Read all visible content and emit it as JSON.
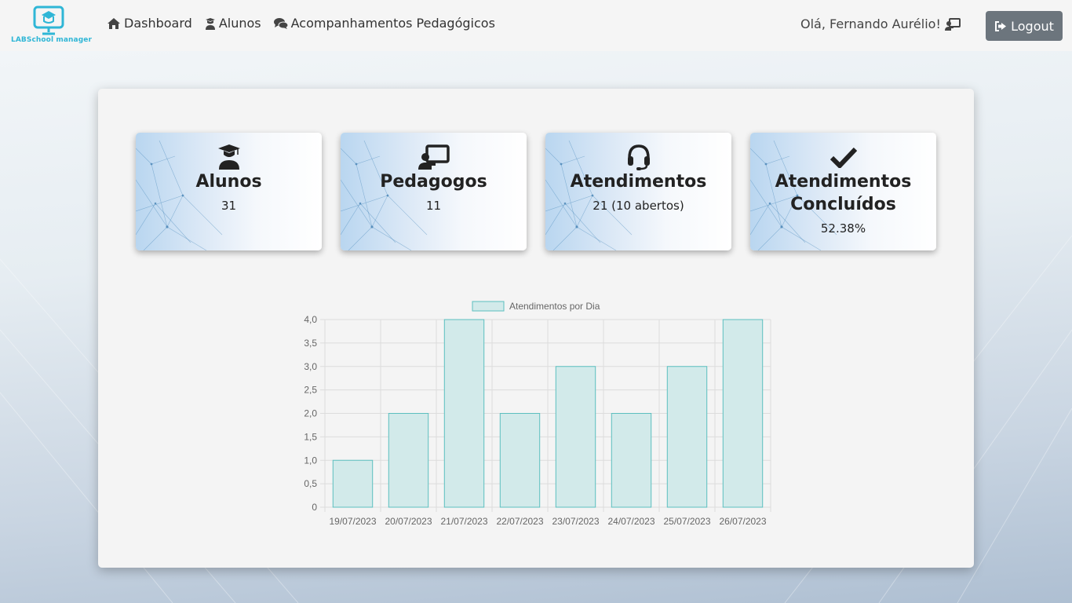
{
  "brand": {
    "name": "LABSchool manager"
  },
  "nav": {
    "items": [
      {
        "label": "Dashboard",
        "icon": "home-icon"
      },
      {
        "label": "Alunos",
        "icon": "student-icon"
      },
      {
        "label": "Acompanhamentos Pedagógicos",
        "icon": "comments-icon"
      }
    ]
  },
  "user": {
    "greeting": "Olá, Fernando Aurélio!"
  },
  "logout": {
    "label": "Logout"
  },
  "cards": [
    {
      "title": "Alunos",
      "value": "31",
      "icon": "graduation-cap-icon"
    },
    {
      "title": "Pedagogos",
      "value": "11",
      "icon": "chalkboard-teacher-icon"
    },
    {
      "title": "Atendimentos",
      "value": "21 (10 abertos)",
      "icon": "headset-icon"
    },
    {
      "title": "Atendimentos Concluídos",
      "value": "52.38%",
      "icon": "check-icon"
    }
  ],
  "colors": {
    "bar_fill": "#d2eaea",
    "bar_stroke": "#5cbfbf",
    "grid": "#dcdcdc",
    "logout_bg": "#6c757d",
    "brand": "#2fb6d6"
  },
  "chart_data": {
    "type": "bar",
    "legend": "Atendimentos por Dia",
    "legend_position": "top",
    "categories": [
      "19/07/2023",
      "20/07/2023",
      "21/07/2023",
      "22/07/2023",
      "23/07/2023",
      "24/07/2023",
      "25/07/2023",
      "26/07/2023"
    ],
    "values": [
      1,
      2,
      4,
      2,
      3,
      2,
      3,
      4
    ],
    "yticks": [
      "0",
      "0,5",
      "1,0",
      "1,5",
      "2,0",
      "2,5",
      "3,0",
      "3,5",
      "4,0"
    ],
    "ylim": [
      0,
      4
    ],
    "grid": true
  }
}
